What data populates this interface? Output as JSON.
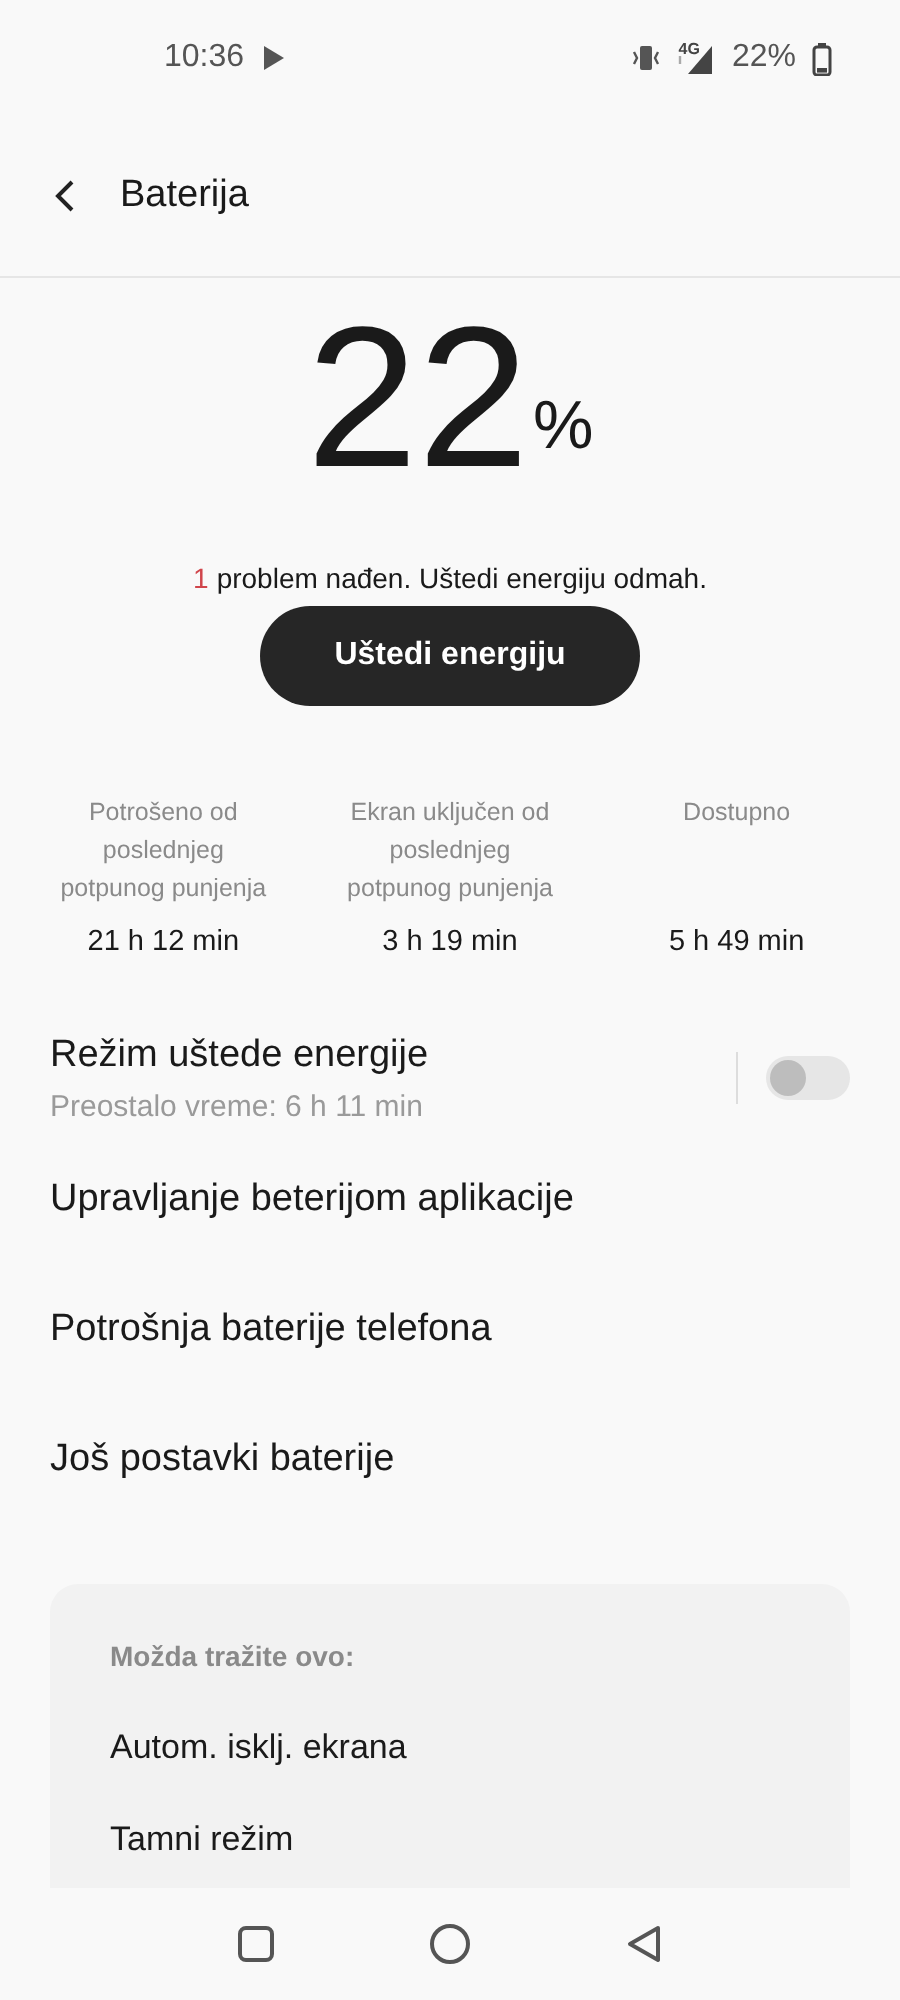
{
  "status_bar": {
    "time": "10:36",
    "network": "4G",
    "battery_text": "22%"
  },
  "header": {
    "title": "Baterija"
  },
  "battery": {
    "percent": "22",
    "unit": "%"
  },
  "problem": {
    "count": "1",
    "text": "problem nađen. Uštedi energiju odmah."
  },
  "action_button": "Uštedi energiju",
  "stats": [
    {
      "label": "Potrošeno od poslednjeg potpunog punjenja",
      "value": "21 h 12 min"
    },
    {
      "label": "Ekran uključen od poslednjeg potpunog punjenja",
      "value": "3 h 19 min"
    },
    {
      "label": "Dostupno",
      "value": "5 h 49 min"
    }
  ],
  "power_saving": {
    "title": "Režim uštede energije",
    "subtitle": "Preostalo vreme:  6 h 11 min",
    "on": false
  },
  "menu_items": [
    "Upravljanje beterijom aplikacije",
    "Potrošnja baterije telefona",
    "Još postavki baterije"
  ],
  "suggestions": {
    "heading": "Možda tražite ovo:",
    "items": [
      "Autom. isklj. ekrana",
      "Tamni režim"
    ]
  }
}
